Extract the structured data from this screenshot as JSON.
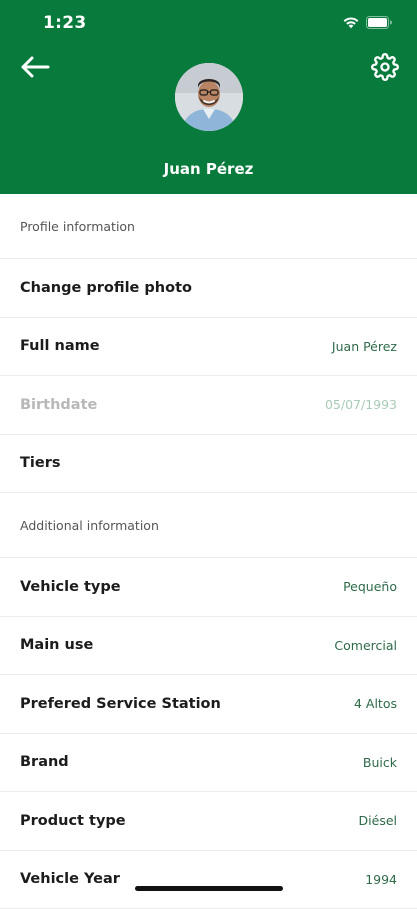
{
  "status_bar": {
    "time": "1:23"
  },
  "header": {
    "user_name": "Juan Pérez"
  },
  "profile_section": {
    "title": "Profile information",
    "rows": [
      {
        "label": "Change profile photo",
        "value": ""
      },
      {
        "label": "Full name",
        "value": "Juan Pérez"
      },
      {
        "label": "Birthdate",
        "value": "05/07/1993",
        "disabled": true
      },
      {
        "label": "Tiers",
        "value": ""
      }
    ]
  },
  "additional_section": {
    "title": "Additional information",
    "rows": [
      {
        "label": "Vehicle type",
        "value": "Pequeño"
      },
      {
        "label": "Main use",
        "value": "Comercial"
      },
      {
        "label": "Prefered Service Station",
        "value": "4 Altos"
      },
      {
        "label": "Brand",
        "value": "Buick"
      },
      {
        "label": "Product type",
        "value": "Diésel"
      },
      {
        "label": "Vehicle Year",
        "value": "1994"
      }
    ]
  },
  "theme": {
    "primary": "#087a3c",
    "value_text": "#2e6a49"
  }
}
